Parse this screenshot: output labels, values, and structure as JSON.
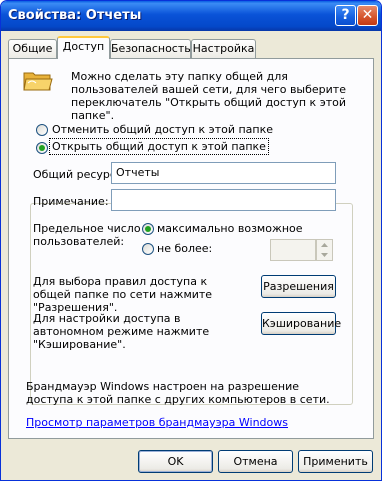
{
  "window": {
    "title": "Свойства: Отчеты"
  },
  "titlebar": {
    "help_glyph": "?",
    "close_glyph": "✕"
  },
  "tabs": [
    {
      "label": "Общие",
      "active": false
    },
    {
      "label": "Доступ",
      "active": true
    },
    {
      "label": "Безопасность",
      "active": false
    },
    {
      "label": "Настройка",
      "active": false
    }
  ],
  "sharing": {
    "description": "Можно сделать эту папку общей для пользователей вашей сети, для чего выберите переключатель \"Открыть общий доступ к этой папке\".",
    "option_unshare": "Отменить общий доступ к этой папке",
    "option_share": "Открыть общий доступ к этой папке",
    "share_name_label": "Общий ресурс:",
    "share_name_value": "Отчеты",
    "comment_label": "Примечание:",
    "comment_value": "",
    "user_limit_label": "Предельное число пользователей:",
    "limit_max_label": "максимально возможное",
    "limit_n_label": "не более:",
    "limit_n_value": "",
    "limit_max_selected": true,
    "permissions_text": "Для выбора правил доступа к общей папке по сети нажмите \"Разрешения\".",
    "permissions_button": "Разрешения",
    "caching_text": "Для настройки доступа в автономном режиме нажмите \"Кэширование\".",
    "caching_button": "Кэширование"
  },
  "firewall": {
    "text": "Брандмауэр Windows настроен на разрешение доступа к этой папке с других компьютеров в сети.",
    "link": "Просмотр параметров брандмауэра Windows"
  },
  "footer": {
    "ok": "OK",
    "cancel": "Отмена",
    "apply": "Применить"
  },
  "colors": {
    "title_bar": "#0a53d8",
    "dialog_bg": "#ece9d8",
    "panel_bg": "#fcfcfe",
    "accent_tab": "#ffc83c",
    "radio_check": "#21a121",
    "link": "#0000ff"
  }
}
